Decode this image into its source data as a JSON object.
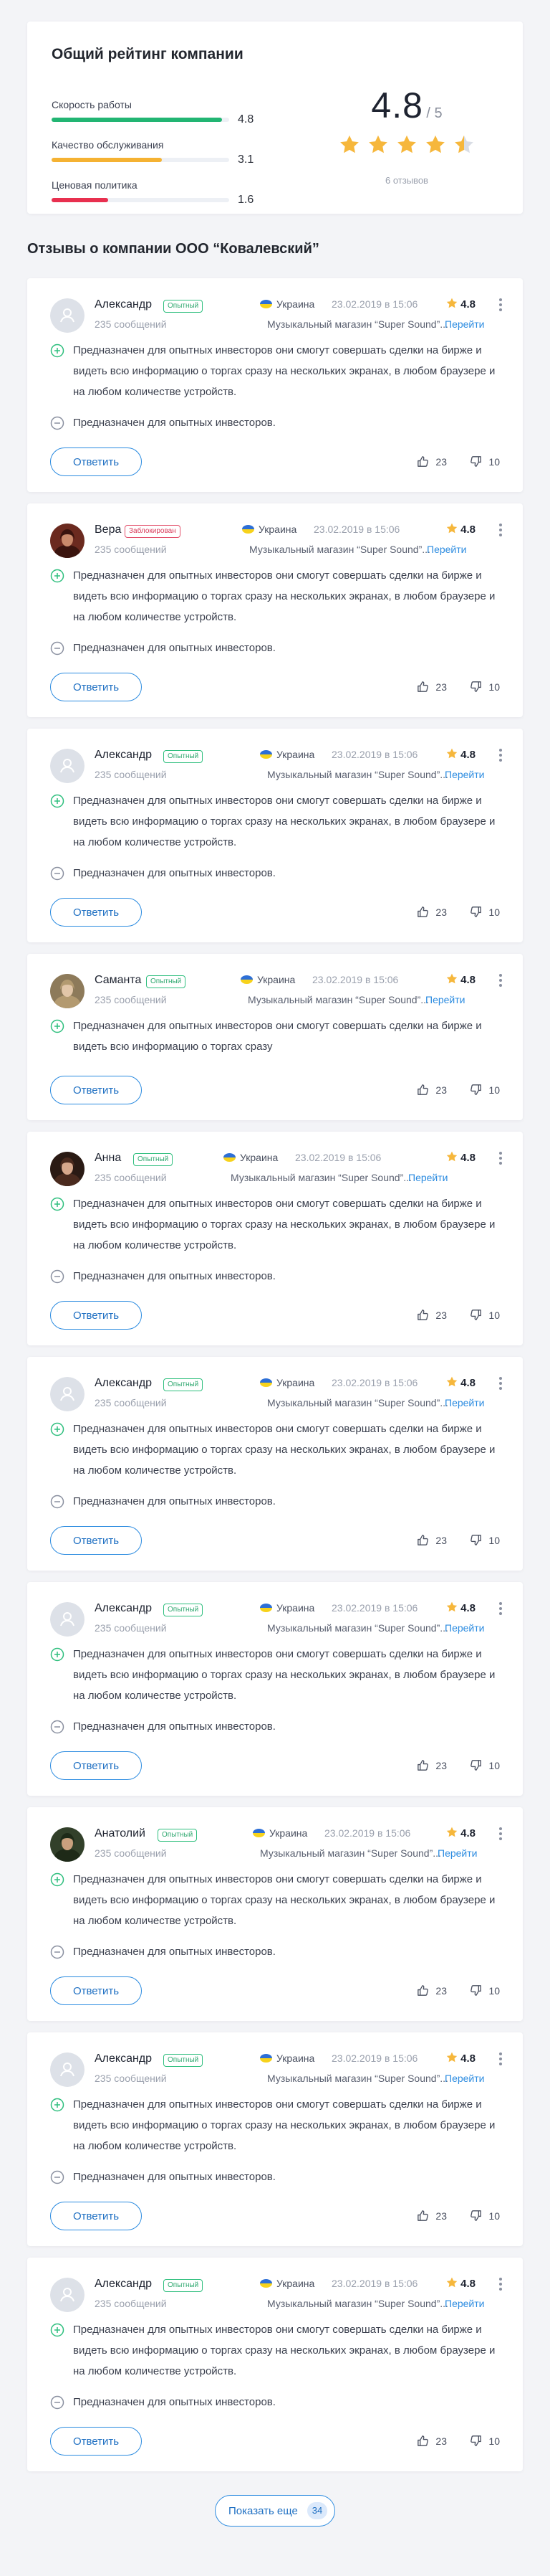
{
  "rating_card": {
    "title": "Общий рейтинг компании",
    "metrics": [
      {
        "label": "Скорость работы",
        "value": "4.8",
        "fraction": 0.96,
        "color": "#22b573"
      },
      {
        "label": "Качество обслуживания",
        "value": "3.1",
        "fraction": 0.62,
        "color": "#f5b232"
      },
      {
        "label": "Ценовая политика",
        "value": "1.6",
        "fraction": 0.32,
        "color": "#e8304f"
      }
    ],
    "overall": {
      "value": "4.8",
      "max": "/ 5",
      "stars": 4.5
    },
    "reviews_count": "6 отзывов"
  },
  "section_title": "Отзывы о компании ООО “Ковалевский”",
  "colors": {
    "accent": "#2b8be0",
    "star": "#f6b73c",
    "positive": "#2fbf7e",
    "negative": "#8a90a0"
  },
  "reviews": [
    {
      "name": "Александр",
      "badge": "Опытный",
      "badge_type": "experienced",
      "avatar": "placeholder-user-icon",
      "country": "Украина",
      "date": "23.02.2019 в 15:06",
      "rating": "4.8",
      "messages": "235 сообщений",
      "product": "Музыкальный магазин “Super Sound”...",
      "link": "Перейти",
      "pro": "Предназначен для опытных инвесторов они смогут совершать сделки на бирже и видеть всю информацию о торгах сразу на нескольких экранах, в любом браузере и на любом количестве устройств.",
      "con": "Предназначен для опытных инвесторов.",
      "reply": "Ответить",
      "likes": "23",
      "dislikes": "10"
    },
    {
      "name": "Вера",
      "badge": "Заблокирован",
      "badge_type": "blocked",
      "avatar": "photo-avatar-vera",
      "country": "Украина",
      "date": "23.02.2019 в 15:06",
      "rating": "4.8",
      "messages": "235 сообщений",
      "product": "Музыкальный магазин “Super Sound”...",
      "link": "Перейти",
      "pro": "Предназначен для опытных инвесторов они смогут совершать сделки на бирже и видеть всю информацию о торгах сразу на нескольких экранах, в любом браузере и на любом количестве устройств.",
      "con": "Предназначен для опытных инвесторов.",
      "reply": "Ответить",
      "likes": "23",
      "dislikes": "10"
    },
    {
      "name": "Александр",
      "badge": "Опытный",
      "badge_type": "experienced",
      "avatar": "placeholder-user-icon",
      "country": "Украина",
      "date": "23.02.2019 в 15:06",
      "rating": "4.8",
      "messages": "235 сообщений",
      "product": "Музыкальный магазин “Super Sound”...",
      "link": "Перейти",
      "pro": "Предназначен для опытных инвесторов они смогут совершать сделки на бирже и видеть всю информацию о торгах сразу на нескольких экранах, в любом браузере и на любом количестве устройств.",
      "con": "Предназначен для опытных инвесторов.",
      "reply": "Ответить",
      "likes": "23",
      "dislikes": "10"
    },
    {
      "name": "Саманта",
      "badge": "Опытный",
      "badge_type": "experienced",
      "avatar": "photo-avatar-samanta",
      "country": "Украина",
      "date": "23.02.2019 в 15:06",
      "rating": "4.8",
      "messages": "235 сообщений",
      "product": "Музыкальный магазин “Super Sound”...",
      "link": "Перейти",
      "pro": "Предназначен для опытных инвесторов они смогут совершать сделки на бирже и видеть всю информацию о торгах сразу",
      "con": "",
      "reply": "Ответить",
      "likes": "23",
      "dislikes": "10"
    },
    {
      "name": "Анна",
      "badge": "Опытный",
      "badge_type": "experienced",
      "avatar": "photo-avatar-anna",
      "country": "Украина",
      "date": "23.02.2019 в 15:06",
      "rating": "4.8",
      "messages": "235 сообщений",
      "product": "Музыкальный магазин “Super Sound”...",
      "link": "Перейти",
      "pro": "Предназначен для опытных инвесторов они смогут совершать сделки на бирже и видеть всю информацию о торгах сразу на нескольких экранах, в любом браузере и на любом количестве устройств.",
      "con": "Предназначен для опытных инвесторов.",
      "reply": "Ответить",
      "likes": "23",
      "dislikes": "10"
    },
    {
      "name": "Александр",
      "badge": "Опытный",
      "badge_type": "experienced",
      "avatar": "placeholder-user-icon",
      "country": "Украина",
      "date": "23.02.2019 в 15:06",
      "rating": "4.8",
      "messages": "235 сообщений",
      "product": "Музыкальный магазин “Super Sound”...",
      "link": "Перейти",
      "pro": "Предназначен для опытных инвесторов они смогут совершать сделки на бирже и видеть всю информацию о торгах сразу на нескольких экранах, в любом браузере и на любом количестве устройств.",
      "con": "Предназначен для опытных инвесторов.",
      "reply": "Ответить",
      "likes": "23",
      "dislikes": "10"
    },
    {
      "name": "Александр",
      "badge": "Опытный",
      "badge_type": "experienced",
      "avatar": "placeholder-user-icon",
      "country": "Украина",
      "date": "23.02.2019 в 15:06",
      "rating": "4.8",
      "messages": "235 сообщений",
      "product": "Музыкальный магазин “Super Sound”...",
      "link": "Перейти",
      "pro": "Предназначен для опытных инвесторов они смогут совершать сделки на бирже и видеть всю информацию о торгах сразу на нескольких экранах, в любом браузере и на любом количестве устройств.",
      "con": "Предназначен для опытных инвесторов.",
      "reply": "Ответить",
      "likes": "23",
      "dislikes": "10"
    },
    {
      "name": "Анатолий",
      "badge": "Опытный",
      "badge_type": "experienced",
      "avatar": "photo-avatar-anatoliy",
      "country": "Украина",
      "date": "23.02.2019 в 15:06",
      "rating": "4.8",
      "messages": "235 сообщений",
      "product": "Музыкальный магазин “Super Sound”...",
      "link": "Перейти",
      "pro": "Предназначен для опытных инвесторов они смогут совершать сделки на бирже и видеть всю информацию о торгах сразу на нескольких экранах, в любом браузере и на любом количестве устройств.",
      "con": "Предназначен для опытных инвесторов.",
      "reply": "Ответить",
      "likes": "23",
      "dislikes": "10"
    },
    {
      "name": "Александр",
      "badge": "Опытный",
      "badge_type": "experienced",
      "avatar": "placeholder-user-icon",
      "country": "Украина",
      "date": "23.02.2019 в 15:06",
      "rating": "4.8",
      "messages": "235 сообщений",
      "product": "Музыкальный магазин “Super Sound”...",
      "link": "Перейти",
      "pro": "Предназначен для опытных инвесторов они смогут совершать сделки на бирже и видеть всю информацию о торгах сразу на нескольких экранах, в любом браузере и на любом количестве устройств.",
      "con": "Предназначен для опытных инвесторов.",
      "reply": "Ответить",
      "likes": "23",
      "dislikes": "10"
    },
    {
      "name": "Александр",
      "badge": "Опытный",
      "badge_type": "experienced",
      "avatar": "placeholder-user-icon",
      "country": "Украина",
      "date": "23.02.2019 в 15:06",
      "rating": "4.8",
      "messages": "235 сообщений",
      "product": "Музыкальный магазин “Super Sound”...",
      "link": "Перейти",
      "pro": "Предназначен для опытных инвесторов они смогут совершать сделки на бирже и видеть всю информацию о торгах сразу на нескольких экранах, в любом браузере и на любом количестве устройств.",
      "con": "Предназначен для опытных инвесторов.",
      "reply": "Ответить",
      "likes": "23",
      "dislikes": "10"
    }
  ],
  "load_more": {
    "label": "Показать еще",
    "count": "34"
  }
}
